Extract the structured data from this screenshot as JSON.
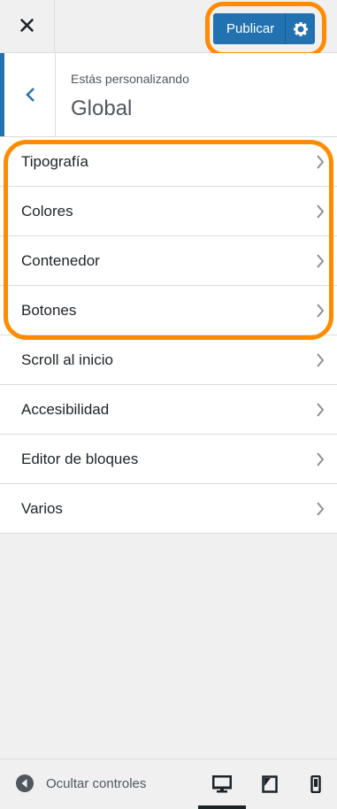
{
  "topbar": {
    "close_icon": "close-icon",
    "publish_label": "Publicar",
    "settings_icon": "gear-icon"
  },
  "customizing": {
    "label": "Estás personalizando",
    "title": "Global",
    "back_icon": "chevron-left-icon"
  },
  "menu": {
    "items": [
      {
        "label": "Tipografía"
      },
      {
        "label": "Colores"
      },
      {
        "label": "Contenedor"
      },
      {
        "label": "Botones"
      },
      {
        "label": "Scroll al inicio"
      },
      {
        "label": "Accesibilidad"
      },
      {
        "label": "Editor de bloques"
      },
      {
        "label": "Varios"
      }
    ]
  },
  "footer": {
    "hide_controls_label": "Ocultar controles",
    "devices": [
      "desktop-icon",
      "tablet-icon",
      "mobile-icon"
    ],
    "active_device": "desktop"
  },
  "colors": {
    "accent": "#2271b1",
    "highlight": "#ff8c00"
  }
}
